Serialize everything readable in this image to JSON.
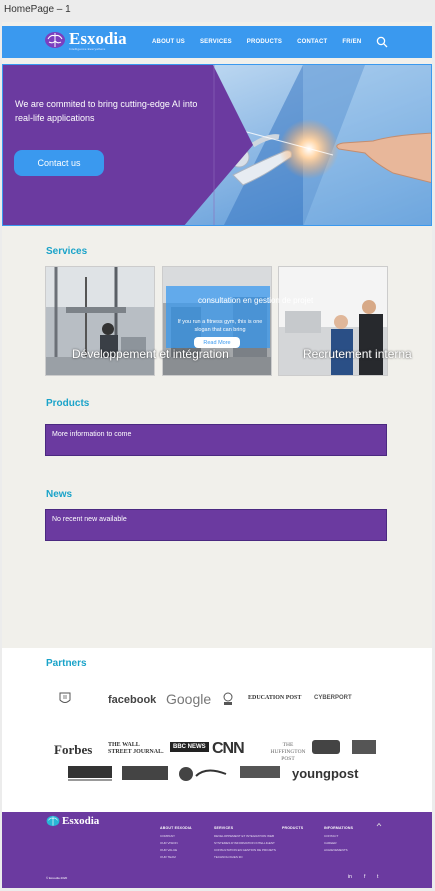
{
  "artboard": {
    "label": "HomePage – 1"
  },
  "nav": {
    "logo_name": "Esxodia",
    "logo_tagline": "Intelligence Everywhere",
    "items": [
      "ABOUT US",
      "SERVICES",
      "PRODUCTS",
      "CONTACT",
      "FR/EN"
    ],
    "search_icon": "search-icon"
  },
  "hero": {
    "tagline": "We are commited to bring cutting-edge AI into real-life applications",
    "cta": "Contact us"
  },
  "services": {
    "title": "Services",
    "cards": [
      {
        "caption": "Développement et intégration"
      },
      {
        "overlay_title": "consultation en gestion de projet",
        "overlay_body": "If you run a fitness gym, this is one slogan that can bring",
        "overlay_button": "Read More"
      },
      {
        "caption": "Recrutement interna"
      }
    ]
  },
  "products": {
    "title": "Products",
    "message": "More information to come"
  },
  "news": {
    "title": "News",
    "message": "No recent new available"
  },
  "partners": {
    "title": "Partners",
    "row1": [
      "facebook",
      "Google",
      "EDUCATION POST",
      "CYBERPORT"
    ],
    "row2": [
      "Forbes",
      "THE WALL STREET JOURNAL.",
      "BBC NEWS",
      "CNN",
      "THE HUFFINGTON POST",
      "youngpost"
    ]
  },
  "footer": {
    "logo_name": "Esxodia",
    "columns": [
      {
        "heading": "ABOUT ESXODIA",
        "items": [
          "COMPANY",
          "OUR VISION",
          "OUR VALUE",
          "OUR TEAM"
        ]
      },
      {
        "heading": "SERVICES",
        "items": [
          "DEVELOPPEMENT ET INTEGRATION WEB",
          "SYSTEMES D'INFORMATION INTELLIGENT",
          "CONSULTATION EN GESTION DE PROJETS",
          "TECHNOLOGIES 3D"
        ]
      },
      {
        "heading": "PRODUCTS",
        "items": []
      },
      {
        "heading": "INFORMATIONS",
        "items": [
          "CONTACT",
          "CAREER",
          "ACHIEVEMENTS"
        ]
      }
    ],
    "copyright": "© Esxodia 2020",
    "social": [
      "in",
      "f",
      "t"
    ]
  },
  "colors": {
    "nav": "#3a99ef",
    "purple": "#6b3aa0",
    "accent_title": "#1aa3c9",
    "background": "#f1f0eb"
  }
}
